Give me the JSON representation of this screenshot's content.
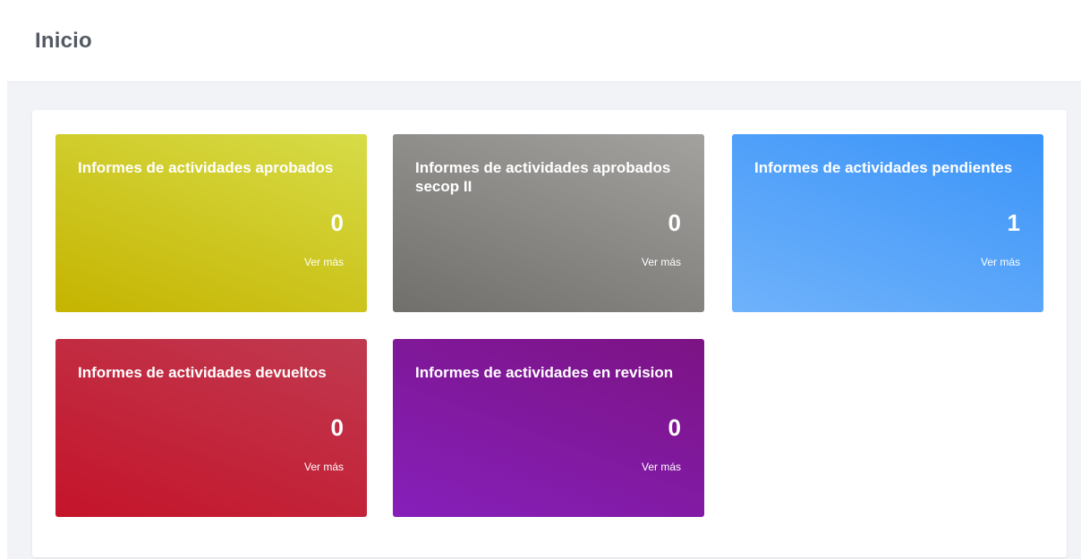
{
  "header": {
    "title": "Inicio"
  },
  "cards": [
    {
      "title": "Informes de actividades aprobados",
      "count": "0",
      "link_label": "Ver más"
    },
    {
      "title": "Informes de actividades aprobados secop II",
      "count": "0",
      "link_label": "Ver más"
    },
    {
      "title": "Informes de actividades pendientes",
      "count": "1",
      "link_label": "Ver más"
    },
    {
      "title": "Informes de actividades devueltos",
      "count": "0",
      "link_label": "Ver más"
    },
    {
      "title": "Informes de actividades en revision",
      "count": "0",
      "link_label": "Ver más"
    }
  ],
  "colors": {
    "aprobados": "#cfc51f",
    "secop": "#8a8986",
    "pendientes": "#4fa0f9",
    "devueltos": "#c12740",
    "revision": "#831aa8"
  }
}
